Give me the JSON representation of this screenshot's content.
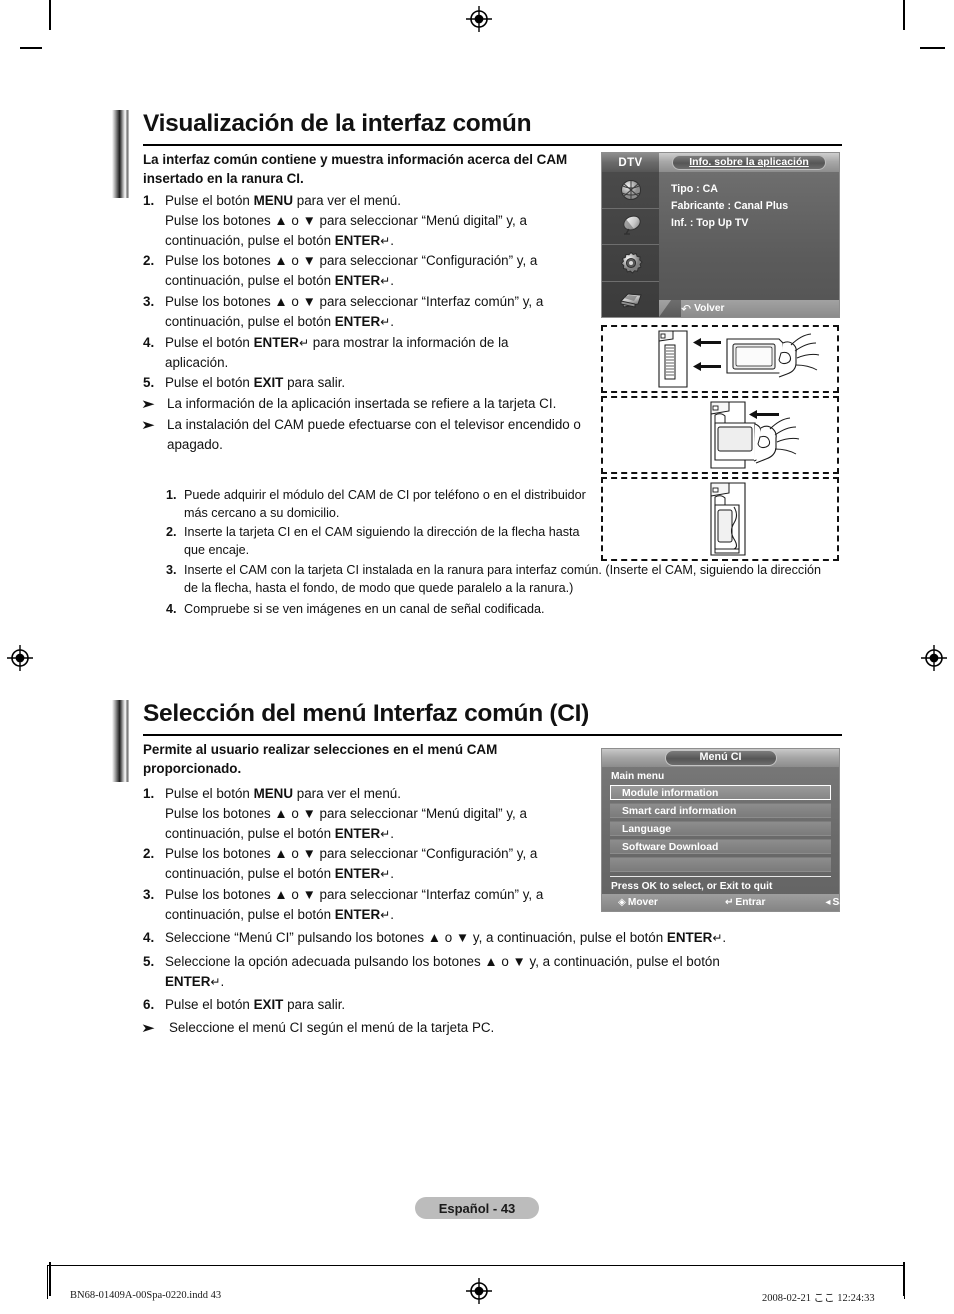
{
  "document": {
    "page_badge": "Español - 43",
    "colophon_left": "BN68-01409A-00Spa-0220.indd   43",
    "colophon_right": "2008-02-21   ここ 12:24:33"
  },
  "section1": {
    "heading": "Visualización de la interfaz común",
    "lead": "La interfaz común contiene y muestra información acerca del CAM insertado en la ranura CI.",
    "steps": [
      {
        "num": "1.",
        "line1_a": "Pulse el botón ",
        "line1_b": "MENU",
        "line1_c": " para ver el menú.",
        "line2": "Pulse los botones ▲ o ▼ para seleccionar “Menú digital” y, a",
        "line3_a": "continuación, pulse el botón ",
        "line3_b": "ENTER",
        "line3_c": "."
      },
      {
        "num": "2.",
        "line1": "Pulse los botones ▲ o ▼ para seleccionar “Configuración” y, a",
        "line2_a": "continuación, pulse el botón ",
        "line2_b": "ENTER",
        "line2_c": "."
      },
      {
        "num": "3.",
        "line1": "Pulse los botones ▲ o ▼ para seleccionar “Interfaz común” y, a",
        "line2_a": "continuación, pulse el botón ",
        "line2_b": "ENTER",
        "line2_c": "."
      },
      {
        "num": "4.",
        "line1_a": "Pulse el botón ",
        "line1_b": "ENTER",
        "line1_c": " para mostrar la información de la",
        "line2": "aplicación."
      },
      {
        "num": "5.",
        "line1_a": "Pulse el botón ",
        "line1_b": "EXIT",
        "line1_c": " para salir."
      }
    ],
    "notes": [
      "La información de la aplicación insertada se refiere a la tarjeta CI.",
      "La instalación del CAM puede efectuarse con el televisor encendido o apagado."
    ],
    "substeps": [
      {
        "num": "1.",
        "text": "Puede adquirir el módulo del CAM de CI por teléfono o en el distribuidor más cercano a su domicilio."
      },
      {
        "num": "2.",
        "text": "Inserte la tarjeta CI en el CAM siguiendo la dirección de la flecha hasta que encaje."
      },
      {
        "num": "3.",
        "text": "Inserte el CAM con la tarjeta CI instalada en la ranura para interfaz común. (Inserte el CAM, siguiendo la dirección de la flecha, hasta el fondo, de modo que quede paralelo a la ranura.)"
      },
      {
        "num": "4.",
        "text": "Compruebe si se ven imágenes en un canal de señal codificada."
      }
    ]
  },
  "osd_app_info": {
    "source_label": "DTV",
    "title": "Info. sobre la aplicación",
    "lines": [
      "Tipo : CA",
      "Fabricante : Canal Plus",
      "Inf. : Top Up TV"
    ],
    "back_label": "Volver",
    "icon_names": [
      "broadcast-icon",
      "satellite-dish-icon",
      "gear-setup-icon",
      "input-source-icon"
    ]
  },
  "section2": {
    "heading": "Selección del menú Interfaz común (CI)",
    "lead": "Permite al usuario realizar selecciones en el menú CAM proporcionado.",
    "steps": [
      {
        "num": "1.",
        "line1_a": "Pulse el botón ",
        "line1_b": "MENU",
        "line1_c": " para ver el menú.",
        "line2": "Pulse los botones ▲ o ▼ para seleccionar “Menú digital” y, a",
        "line3_a": "continuación, pulse el botón ",
        "line3_b": "ENTER",
        "line3_c": "."
      },
      {
        "num": "2.",
        "line1": "Pulse los botones ▲ o ▼ para seleccionar “Configuración” y, a",
        "line2_a": "continuación, pulse el botón ",
        "line2_b": "ENTER",
        "line2_c": "."
      },
      {
        "num": "3.",
        "line1": "Pulse los botones ▲ o ▼ para seleccionar “Interfaz común” y, a",
        "line2_a": "continuación, pulse el botón ",
        "line2_b": "ENTER",
        "line2_c": "."
      },
      {
        "num": "4.",
        "line1_a": "Seleccione “Menú CI” pulsando los botones ▲ o ▼ y, a continuación, pulse el botón ",
        "line1_b": "ENTER",
        "line1_c": "."
      },
      {
        "num": "5.",
        "line1": "Seleccione la opción adecuada pulsando los botones ▲ o ▼ y, a continuación, pulse el botón",
        "line2_b": "ENTER",
        "line2_c": "."
      },
      {
        "num": "6.",
        "line1_a": "Pulse el botón ",
        "line1_b": "EXIT",
        "line1_c": " para salir."
      }
    ],
    "notes": [
      "Seleccione el menú CI según el menú de la tarjeta PC."
    ]
  },
  "osd_ci_menu": {
    "title": "Menú CI",
    "subtitle": "Main menu",
    "items": [
      {
        "label": "Module information",
        "selected": true
      },
      {
        "label": "Smart card information",
        "selected": false
      },
      {
        "label": "Language",
        "selected": false
      },
      {
        "label": "Software Download",
        "selected": false
      },
      {
        "label": "",
        "selected": false
      }
    ],
    "hint": "Press OK to select, or Exit to quit",
    "footer": [
      {
        "glyph": "✧",
        "label": "Mover"
      },
      {
        "glyph": "↵",
        "label": "Entrar"
      },
      {
        "glyph": "◁",
        "label": "Salir"
      }
    ]
  }
}
